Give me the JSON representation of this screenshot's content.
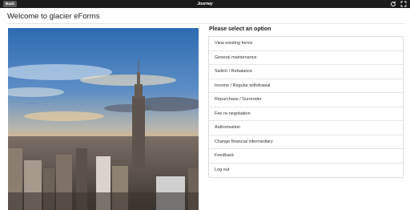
{
  "topbar": {
    "back_label": "Back",
    "title": "Journey",
    "icons": [
      "refresh-icon",
      "fullscreen-icon"
    ]
  },
  "welcome": "Welcome to glacier eForms",
  "hero_image": "city-skyline-photo",
  "options": {
    "heading": "Please select an option",
    "items": [
      "View existing forms",
      "General maintenance",
      "Switch / Rebalance",
      "Income / Regular withdrawal",
      "Repurchase / Surrender",
      "Fee re-negotiation",
      "Authorisation",
      "Change financial intermediary",
      "Feedback",
      "Log out"
    ]
  }
}
